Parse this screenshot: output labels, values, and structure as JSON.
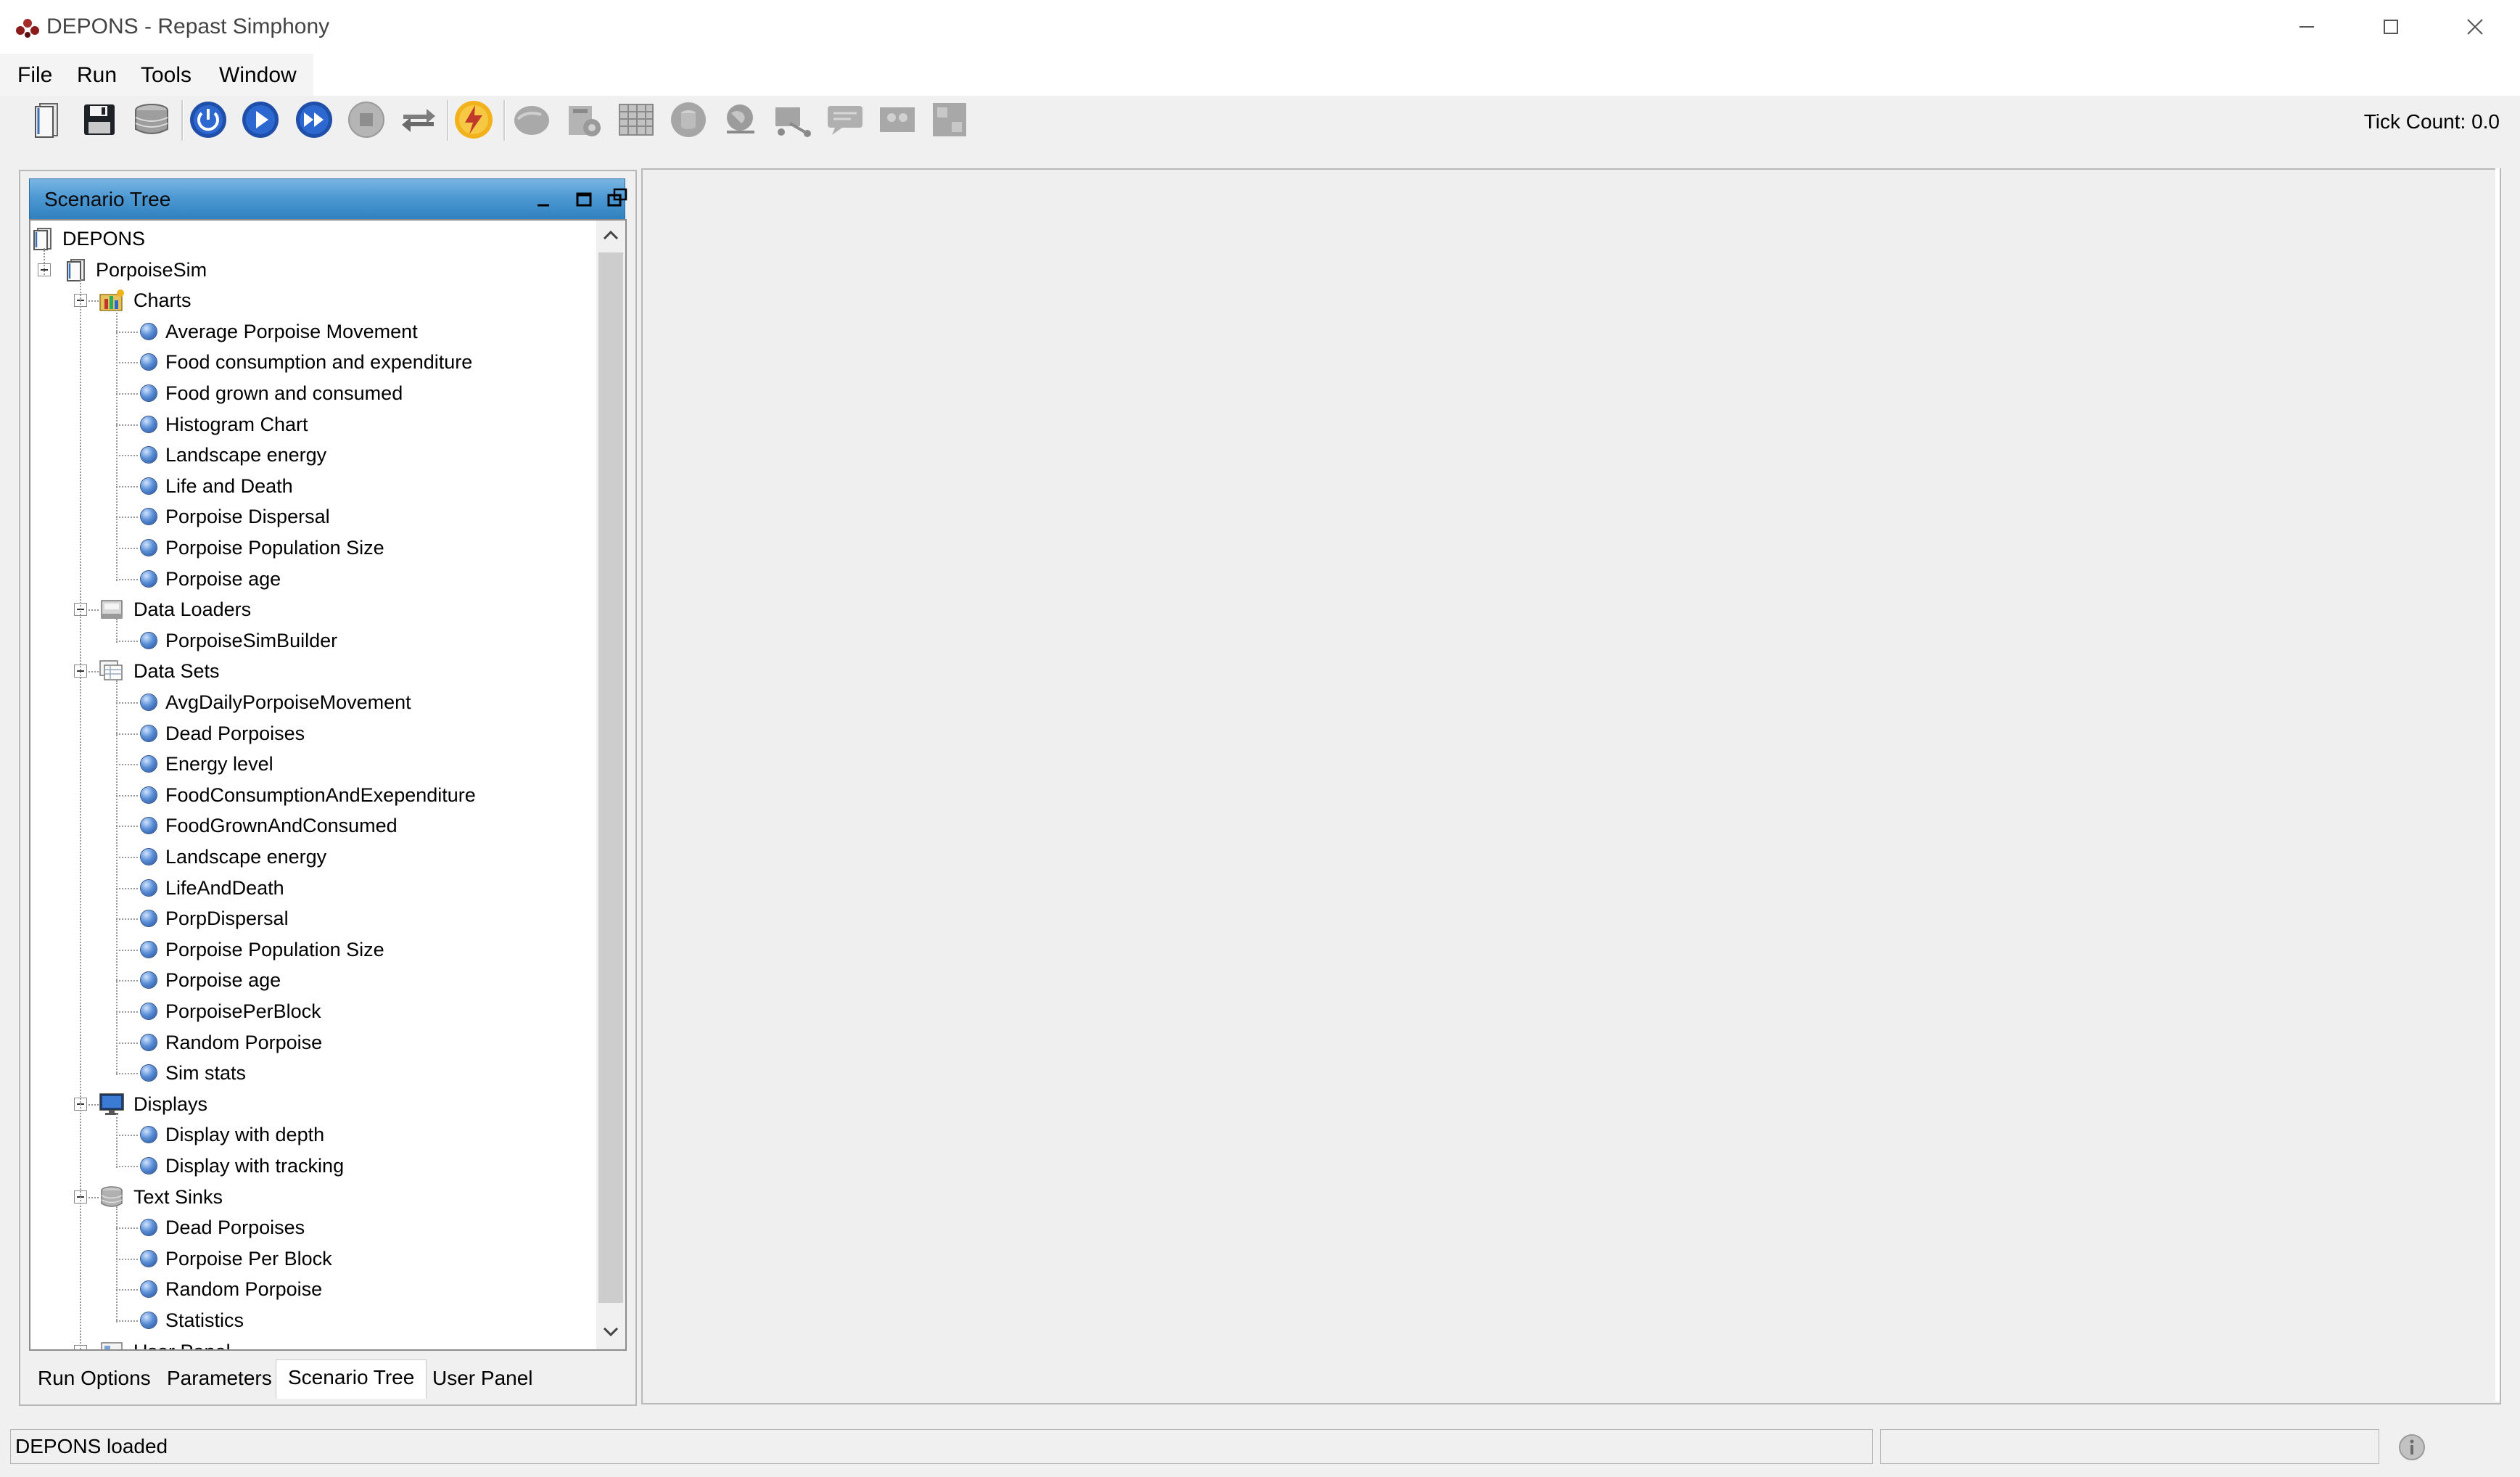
{
  "window": {
    "title": "DEPONS - Repast Simphony"
  },
  "menu": {
    "items": [
      "File",
      "Run",
      "Tools",
      "Window"
    ]
  },
  "toolbar": {
    "tick_count": "Tick Count: 0.0",
    "buttons": [
      "load-scenario-icon",
      "save-icon",
      "database-icon",
      "power-icon",
      "play-icon",
      "fast-forward-icon",
      "stop-icon",
      "reset-icon",
      "lightning-icon",
      "display-icon",
      "chart-settings-icon",
      "grid-icon",
      "cylinder-icon",
      "globe-icon",
      "network-icon",
      "chat-icon",
      "image-icon",
      "matrix-icon"
    ]
  },
  "scenario_tree": {
    "header_title": "Scenario Tree",
    "root": "DEPONS",
    "context": "PorpoiseSim",
    "groups": [
      {
        "label": "Charts",
        "icon": "charts-folder-icon",
        "items": [
          "Average Porpoise Movement",
          "Food consumption and expenditure",
          "Food grown and consumed",
          "Histogram Chart",
          "Landscape energy",
          "Life and Death",
          "Porpoise Dispersal",
          "Porpoise Population Size",
          "Porpoise age"
        ]
      },
      {
        "label": "Data Loaders",
        "icon": "data-loader-icon",
        "items": [
          "PorpoiseSimBuilder"
        ]
      },
      {
        "label": "Data Sets",
        "icon": "data-sets-icon",
        "items": [
          "AvgDailyPorpoiseMovement",
          "Dead Porpoises",
          "Energy level",
          "FoodConsumptionAndExependiture",
          "FoodGrownAndConsumed",
          "Landscape energy",
          "LifeAndDeath",
          "PorpDispersal",
          "Porpoise Population Size",
          "Porpoise age",
          "PorpoisePerBlock",
          "Random Porpoise",
          "Sim stats"
        ]
      },
      {
        "label": "Displays",
        "icon": "monitor-icon",
        "items": [
          "Display with depth",
          "Display with tracking"
        ]
      },
      {
        "label": "Text Sinks",
        "icon": "text-sink-icon",
        "items": [
          "Dead Porpoises",
          "Porpoise Per Block",
          "Random Porpoise",
          "Statistics"
        ]
      },
      {
        "label": "User Panel",
        "icon": "user-panel-icon",
        "items": []
      }
    ]
  },
  "tabs": {
    "items": [
      "Run Options",
      "Parameters",
      "Scenario Tree",
      "User Panel"
    ],
    "active": "Scenario Tree"
  },
  "status": {
    "message": "DEPONS loaded"
  }
}
